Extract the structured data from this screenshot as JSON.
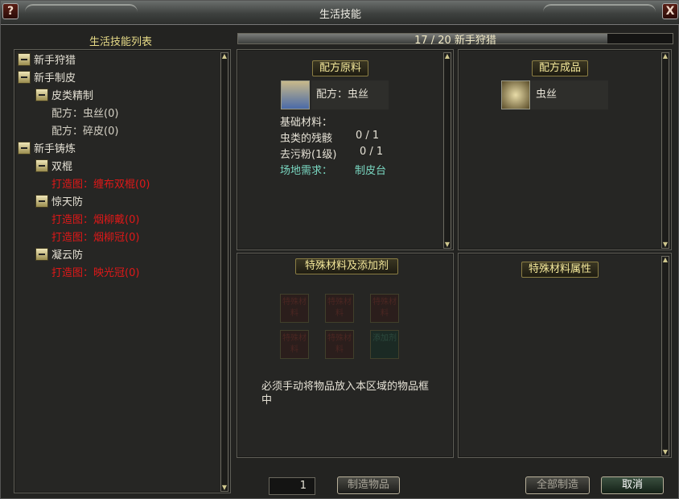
{
  "window": {
    "title": "生活技能",
    "help_icon": "?",
    "close_icon": "X"
  },
  "left": {
    "header": "生活技能列表",
    "tree": [
      {
        "label": "新手狩猎",
        "level": 0,
        "icon": true,
        "color": "normal"
      },
      {
        "label": "新手制皮",
        "level": 0,
        "icon": true,
        "color": "normal"
      },
      {
        "label": "皮类精制",
        "level": 1,
        "icon": true,
        "color": "normal"
      },
      {
        "label": "配方：虫丝(0)",
        "level": 2,
        "icon": false,
        "color": "gray"
      },
      {
        "label": "配方：碎皮(0)",
        "level": 2,
        "icon": false,
        "color": "gray"
      },
      {
        "label": "新手铸炼",
        "level": 0,
        "icon": true,
        "color": "normal"
      },
      {
        "label": "双棍",
        "level": 1,
        "icon": true,
        "color": "normal"
      },
      {
        "label": "打造图：缠布双棍(0)",
        "level": 2,
        "icon": false,
        "color": "red"
      },
      {
        "label": "惊天防",
        "level": 1,
        "icon": true,
        "color": "normal"
      },
      {
        "label": "打造图：烟柳戴(0)",
        "level": 2,
        "icon": false,
        "color": "red"
      },
      {
        "label": "打造图：烟柳冠(0)",
        "level": 2,
        "icon": false,
        "color": "red"
      },
      {
        "label": "凝云防",
        "level": 1,
        "icon": true,
        "color": "normal"
      },
      {
        "label": "打造图：映光冠(0)",
        "level": 2,
        "icon": false,
        "color": "red"
      }
    ]
  },
  "progress": {
    "text": "17 / 20 新手狩猎",
    "fraction": 0.85
  },
  "materials": {
    "header": "配方原料",
    "recipe_name": "配方：虫丝",
    "base_label": "基础材料：",
    "rows": [
      {
        "name": "虫类的残骸",
        "count": "0 / 1"
      },
      {
        "name": "去污粉(1级)",
        "count": "0 / 1"
      }
    ],
    "site_label": "场地需求：",
    "site_value": "制皮台",
    "icon": "scroll-icon"
  },
  "product": {
    "header": "配方成品",
    "name": "虫丝",
    "icon": "skull-icon"
  },
  "special": {
    "header": "特殊材料及添加剂",
    "slot_label": "特殊材料",
    "additive_label": "添加剂",
    "note": "必须手动将物品放入本区域的物品框中"
  },
  "attributes": {
    "header": "特殊材料属性"
  },
  "footer": {
    "quantity": "1",
    "make_label": "制造物品",
    "make_all_label": "全部制造",
    "cancel_label": "取消"
  },
  "colors": {
    "accent": "#e8dc88",
    "red": "#e01818",
    "teal": "#7ad8c2"
  }
}
